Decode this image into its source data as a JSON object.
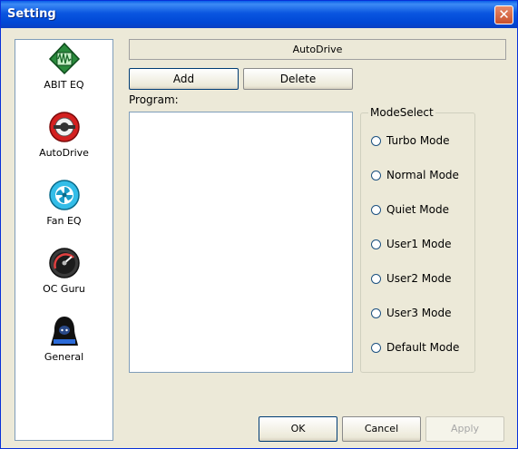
{
  "window": {
    "title": "Setting"
  },
  "sidebar": {
    "items": [
      {
        "label": "ABIT EQ",
        "icon": "abit-eq-icon"
      },
      {
        "label": "AutoDrive",
        "icon": "autodrive-icon"
      },
      {
        "label": "Fan EQ",
        "icon": "fan-eq-icon"
      },
      {
        "label": "OC Guru",
        "icon": "oc-guru-icon"
      },
      {
        "label": "General",
        "icon": "general-icon"
      }
    ]
  },
  "main": {
    "header": "AutoDrive",
    "add_label": "Add",
    "delete_label": "Delete",
    "program_label": "Program:",
    "mode_select": {
      "legend": "ModeSelect",
      "options": [
        "Turbo Mode",
        "Normal Mode",
        "Quiet Mode",
        "User1 Mode",
        "User2 Mode",
        "User3 Mode",
        "Default Mode"
      ]
    }
  },
  "footer": {
    "ok_label": "OK",
    "cancel_label": "Cancel",
    "apply_label": "Apply"
  }
}
